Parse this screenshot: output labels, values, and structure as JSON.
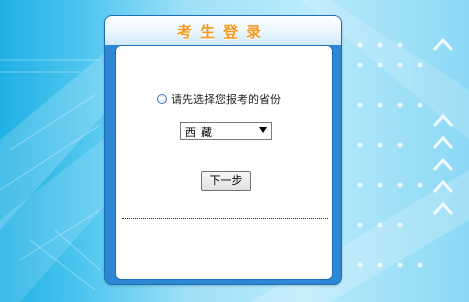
{
  "login_panel": {
    "title": "考生登录",
    "prompt": "请先选择您报考的省份",
    "province_select": {
      "selected": "西藏"
    },
    "next_button_label": "下一步"
  },
  "background": {
    "arrow_icons": [
      "up-arrow-icon",
      "up-arrow-icon",
      "up-arrow-icon",
      "up-arrow-icon",
      "up-arrow-icon",
      "up-arrow-icon"
    ],
    "colors": {
      "base": "#1fb0e4",
      "light": "#b9ebfb"
    }
  },
  "colors": {
    "panel_border": "#2d87d4",
    "title": "#f29a22"
  }
}
